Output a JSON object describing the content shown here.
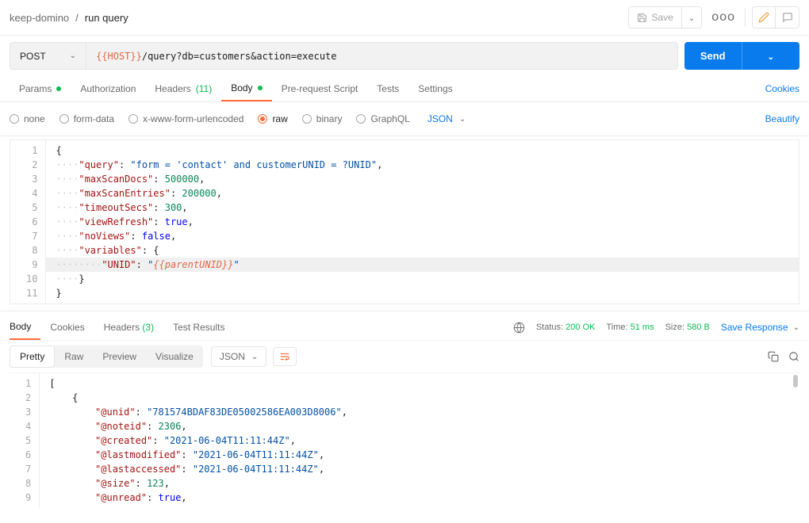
{
  "breadcrumb": {
    "collection": "keep-domino",
    "sep": "/",
    "request": "run query"
  },
  "top": {
    "save": "Save",
    "dots": "ooo"
  },
  "method": "POST",
  "send": "Send",
  "url": {
    "var": "{{HOST}}",
    "rest": "/query?db=customers&action=execute"
  },
  "reqTabs": {
    "params": "Params",
    "authorization": "Authorization",
    "headers": "Headers",
    "headersCount": "(11)",
    "body": "Body",
    "prerequest": "Pre-request Script",
    "tests": "Tests",
    "settings": "Settings",
    "cookies": "Cookies"
  },
  "bodyOpts": {
    "none": "none",
    "formdata": "form-data",
    "xwww": "x-www-form-urlencoded",
    "raw": "raw",
    "binary": "binary",
    "graphql": "GraphQL",
    "json": "JSON",
    "beautify": "Beautify"
  },
  "bodyCode": {
    "l1": "{",
    "k2": "\"query\"",
    "v2": "\"form = 'contact' and customerUNID = ?UNID\"",
    "k3": "\"maxScanDocs\"",
    "v3": "500000",
    "k4": "\"maxScanEntries\"",
    "v4": "200000",
    "k5": "\"timeoutSecs\"",
    "v5": "300",
    "k6": "\"viewRefresh\"",
    "v6": "true",
    "k7": "\"noViews\"",
    "v7": "false",
    "k8": "\"variables\"",
    "k9": "\"UNID\"",
    "v9q": "\"",
    "v9var": "{{parentUNID}}",
    "v9q2": "\"",
    "l11": "}"
  },
  "respTabs": {
    "body": "Body",
    "cookies": "Cookies",
    "headers": "Headers",
    "headersCount": "(3)",
    "tests": "Test Results"
  },
  "respMeta": {
    "statusL": "Status:",
    "statusV": "200 OK",
    "timeL": "Time:",
    "timeV": "51 ms",
    "sizeL": "Size:",
    "sizeV": "580 B",
    "saveResp": "Save Response"
  },
  "viewTabs": {
    "pretty": "Pretty",
    "raw": "Raw",
    "preview": "Preview",
    "visualize": "Visualize",
    "json": "JSON"
  },
  "respCode": {
    "k3": "\"@unid\"",
    "v3": "\"781574BDAF83DE05002586EA003D8006\"",
    "k4": "\"@noteid\"",
    "v4": "2306",
    "k5": "\"@created\"",
    "v5": "\"2021-06-04T11:11:44Z\"",
    "k6": "\"@lastmodified\"",
    "v6": "\"2021-06-04T11:11:44Z\"",
    "k7": "\"@lastaccessed\"",
    "v7": "\"2021-06-04T11:11:44Z\"",
    "k8": "\"@size\"",
    "v8": "123",
    "k9": "\"@unread\"",
    "v9": "true"
  }
}
